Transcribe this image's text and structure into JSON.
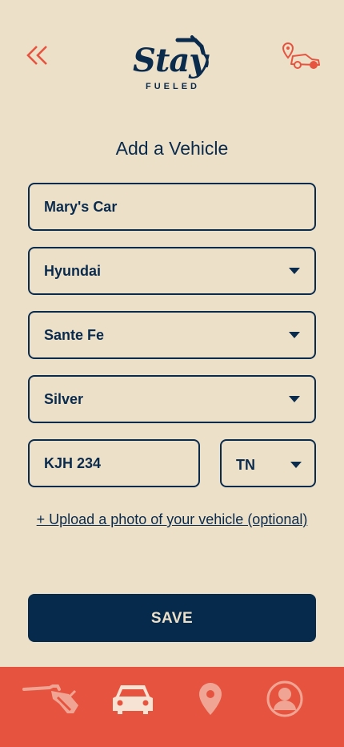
{
  "header": {
    "back_icon": "double-chevron-left-icon",
    "logo_word": "Stay",
    "logo_sub": "FUELED",
    "car_location_icon": "car-location-icon"
  },
  "page": {
    "title": "Add a Vehicle"
  },
  "form": {
    "nickname": "Mary's Car",
    "make": "Hyundai",
    "model": "Sante Fe",
    "color": "Silver",
    "plate": "KJH 234",
    "state": "TN",
    "upload_link": "+ Upload a photo of your vehicle (optional)",
    "save_label": "SAVE"
  },
  "tabbar": {
    "items": [
      {
        "icon": "fuel-nozzle-icon",
        "active": false
      },
      {
        "icon": "car-icon",
        "active": true
      },
      {
        "icon": "location-pin-icon",
        "active": false
      },
      {
        "icon": "profile-icon",
        "active": false
      }
    ]
  },
  "colors": {
    "background": "#ece0c9",
    "navy": "#0b2b4d",
    "accent": "#e65440",
    "tab_inactive": "#f0a594",
    "tab_active": "#f6e3d4"
  }
}
